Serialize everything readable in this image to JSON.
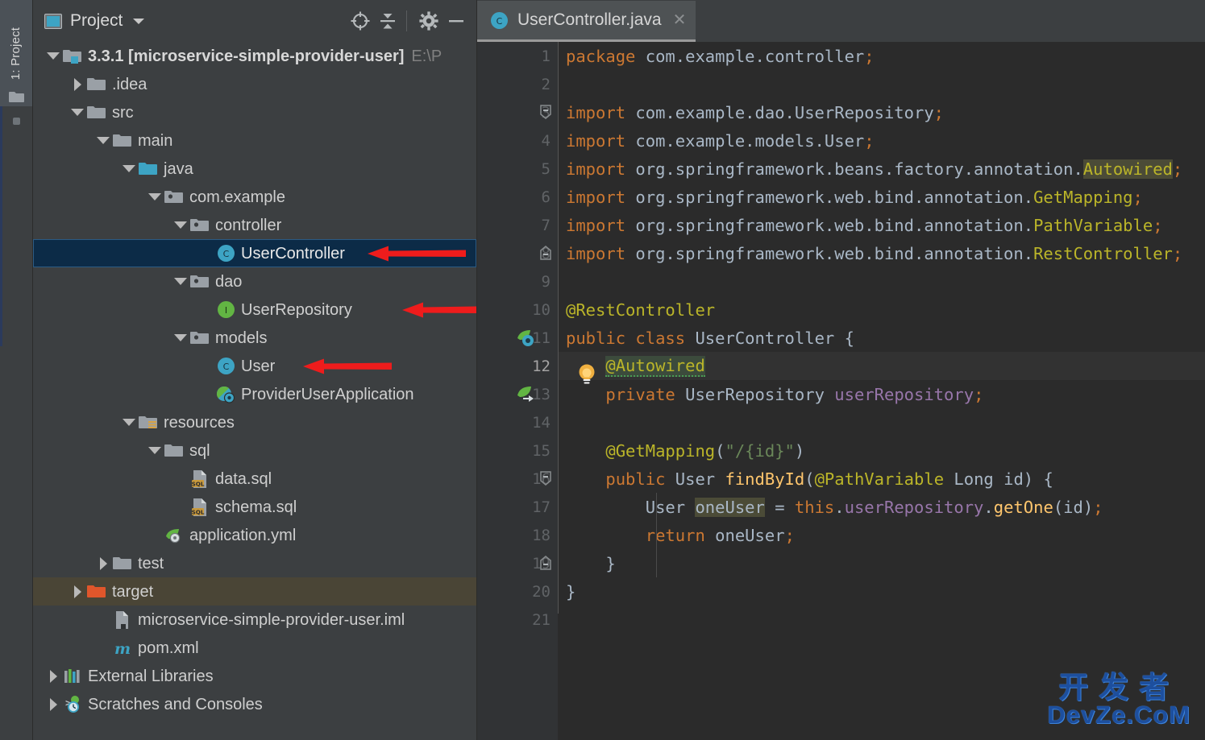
{
  "window": {
    "left_tool_tab": "1: Project",
    "left_tool_tab_icon": "project-folder-icon"
  },
  "project_panel": {
    "title": "Project",
    "title_icon": "project-view-icon",
    "dropdown_icon": "chevron-down-icon",
    "toolbar_buttons": [
      {
        "name": "locate-file-button",
        "icon": "crosshair-target-icon"
      },
      {
        "name": "collapse-all-button",
        "icon": "collapse-all-icon"
      },
      {
        "name": "settings-button",
        "icon": "gear-icon"
      },
      {
        "name": "hide-panel-button",
        "icon": "minimize-icon"
      }
    ],
    "tree": [
      {
        "indent": 0,
        "twisty": "down",
        "icon": "module-folder-icon",
        "label": "3.3.1 [microservice-simple-provider-user]",
        "bold": true,
        "suffix": "E:\\P",
        "state": "normal"
      },
      {
        "indent": 1,
        "twisty": "right",
        "icon": "folder-icon",
        "label": ".idea",
        "bold": false,
        "suffix": "",
        "state": "normal"
      },
      {
        "indent": 1,
        "twisty": "down",
        "icon": "folder-icon",
        "label": "src",
        "bold": false,
        "suffix": "",
        "state": "normal"
      },
      {
        "indent": 2,
        "twisty": "down",
        "icon": "folder-icon",
        "label": "main",
        "bold": false,
        "suffix": "",
        "state": "normal"
      },
      {
        "indent": 3,
        "twisty": "down",
        "icon": "source-root-icon",
        "label": "java",
        "bold": false,
        "suffix": "",
        "state": "normal"
      },
      {
        "indent": 4,
        "twisty": "down",
        "icon": "package-icon",
        "label": "com.example",
        "bold": false,
        "suffix": "",
        "state": "normal"
      },
      {
        "indent": 5,
        "twisty": "down",
        "icon": "package-icon",
        "label": "controller",
        "bold": false,
        "suffix": "",
        "state": "normal"
      },
      {
        "indent": 6,
        "twisty": "none",
        "icon": "java-class-icon",
        "label": "UserController",
        "bold": false,
        "suffix": "",
        "state": "selected"
      },
      {
        "indent": 5,
        "twisty": "down",
        "icon": "package-icon",
        "label": "dao",
        "bold": false,
        "suffix": "",
        "state": "normal"
      },
      {
        "indent": 6,
        "twisty": "none",
        "icon": "java-interface-icon",
        "label": "UserRepository",
        "bold": false,
        "suffix": "",
        "state": "normal"
      },
      {
        "indent": 5,
        "twisty": "down",
        "icon": "package-icon",
        "label": "models",
        "bold": false,
        "suffix": "",
        "state": "normal"
      },
      {
        "indent": 6,
        "twisty": "none",
        "icon": "java-class-icon",
        "label": "User",
        "bold": false,
        "suffix": "",
        "state": "normal"
      },
      {
        "indent": 6,
        "twisty": "none",
        "icon": "spring-boot-app-icon",
        "label": "ProviderUserApplication",
        "bold": false,
        "suffix": "",
        "state": "normal"
      },
      {
        "indent": 3,
        "twisty": "down",
        "icon": "resources-root-icon",
        "label": "resources",
        "bold": false,
        "suffix": "",
        "state": "normal"
      },
      {
        "indent": 4,
        "twisty": "down",
        "icon": "folder-icon",
        "label": "sql",
        "bold": false,
        "suffix": "",
        "state": "normal"
      },
      {
        "indent": 5,
        "twisty": "none",
        "icon": "sql-file-icon",
        "label": "data.sql",
        "bold": false,
        "suffix": "",
        "state": "normal"
      },
      {
        "indent": 5,
        "twisty": "none",
        "icon": "sql-file-icon",
        "label": "schema.sql",
        "bold": false,
        "suffix": "",
        "state": "normal"
      },
      {
        "indent": 4,
        "twisty": "none",
        "icon": "yaml-spring-file-icon",
        "label": "application.yml",
        "bold": false,
        "suffix": "",
        "state": "normal"
      },
      {
        "indent": 2,
        "twisty": "right",
        "icon": "folder-icon",
        "label": "test",
        "bold": false,
        "suffix": "",
        "state": "normal"
      },
      {
        "indent": 1,
        "twisty": "right",
        "icon": "excluded-folder-icon",
        "label": "target",
        "bold": false,
        "suffix": "",
        "state": "excluded"
      },
      {
        "indent": 1,
        "twisty": "none",
        "icon": "iml-file-icon",
        "label": "microservice-simple-provider-user.iml",
        "bold": false,
        "suffix": "",
        "state": "normal"
      },
      {
        "indent": 1,
        "twisty": "none",
        "icon": "maven-pom-icon",
        "label": "pom.xml",
        "bold": false,
        "suffix": "",
        "state": "normal"
      },
      {
        "indent": 0,
        "twisty": "right",
        "icon": "external-libraries-icon",
        "label": "External Libraries",
        "bold": false,
        "suffix": "",
        "state": "normal"
      },
      {
        "indent": 0,
        "twisty": "right",
        "icon": "scratches-icon",
        "label": "Scratches and Consoles",
        "bold": false,
        "suffix": "",
        "state": "normal"
      }
    ],
    "annotation_arrows": [
      {
        "name": "arrow-to-usercontroller",
        "target": "UserController"
      },
      {
        "name": "arrow-to-userrepository",
        "target": "UserRepository"
      },
      {
        "name": "arrow-to-user",
        "target": "User"
      }
    ]
  },
  "editor": {
    "tabs": [
      {
        "label": "UserController.java",
        "icon": "java-class-icon",
        "close_icon": "close-icon",
        "active": true
      }
    ],
    "current_line": 12,
    "line_numbers": [
      "1",
      "2",
      "3",
      "4",
      "5",
      "6",
      "7",
      "8",
      "9",
      "10",
      "11",
      "12",
      "13",
      "14",
      "15",
      "16",
      "17",
      "18",
      "19",
      "20",
      "21"
    ],
    "gutter_marks": [
      {
        "line": 3,
        "icon": "fold-collapse-icon"
      },
      {
        "line": 8,
        "icon": "fold-end-icon"
      },
      {
        "line": 16,
        "icon": "fold-collapse-icon"
      },
      {
        "line": 19,
        "icon": "fold-end-icon"
      }
    ],
    "gutter_icons": [
      {
        "line": 11,
        "icon": "spring-bean-icon"
      },
      {
        "line": 13,
        "icon": "spring-autowired-icon"
      }
    ],
    "inspection_bulb": {
      "line": 11,
      "icon": "intention-bulb-icon"
    },
    "code_lines": [
      {
        "n": 1,
        "text": "package com.example.controller;"
      },
      {
        "n": 2,
        "text": ""
      },
      {
        "n": 3,
        "text": "import com.example.dao.UserRepository;"
      },
      {
        "n": 4,
        "text": "import com.example.models.User;"
      },
      {
        "n": 5,
        "text": "import org.springframework.beans.factory.annotation.Autowired;"
      },
      {
        "n": 6,
        "text": "import org.springframework.web.bind.annotation.GetMapping;"
      },
      {
        "n": 7,
        "text": "import org.springframework.web.bind.annotation.PathVariable;"
      },
      {
        "n": 8,
        "text": "import org.springframework.web.bind.annotation.RestController;"
      },
      {
        "n": 9,
        "text": ""
      },
      {
        "n": 10,
        "text": "@RestController"
      },
      {
        "n": 11,
        "text": "public class UserController {"
      },
      {
        "n": 12,
        "text": "    @Autowired"
      },
      {
        "n": 13,
        "text": "    private UserRepository userRepository;"
      },
      {
        "n": 14,
        "text": ""
      },
      {
        "n": 15,
        "text": "    @GetMapping(\"/{id}\")"
      },
      {
        "n": 16,
        "text": "    public User findById(@PathVariable Long id) {"
      },
      {
        "n": 17,
        "text": "        User oneUser = this.userRepository.getOne(id);"
      },
      {
        "n": 18,
        "text": "        return oneUser;"
      },
      {
        "n": 19,
        "text": "    }"
      },
      {
        "n": 20,
        "text": "}"
      },
      {
        "n": 21,
        "text": ""
      }
    ]
  },
  "watermark": {
    "cn": "开发者",
    "en": "DevZe.CoM"
  },
  "colors": {
    "panel_bg": "#3c3f41",
    "editor_bg": "#2b2b2b",
    "gutter_bg": "#313335",
    "selection_bg": "#0c2b47",
    "excluded_row_bg": "#4a4536",
    "keyword": "#cc7832",
    "string": "#6a8759",
    "annotation": "#bbb529",
    "field": "#9876aa",
    "method": "#ffc66d",
    "plain": "#a9b7c6",
    "arrow_red": "#ee1c1c",
    "watermark_blue": "#1d4f9e"
  }
}
